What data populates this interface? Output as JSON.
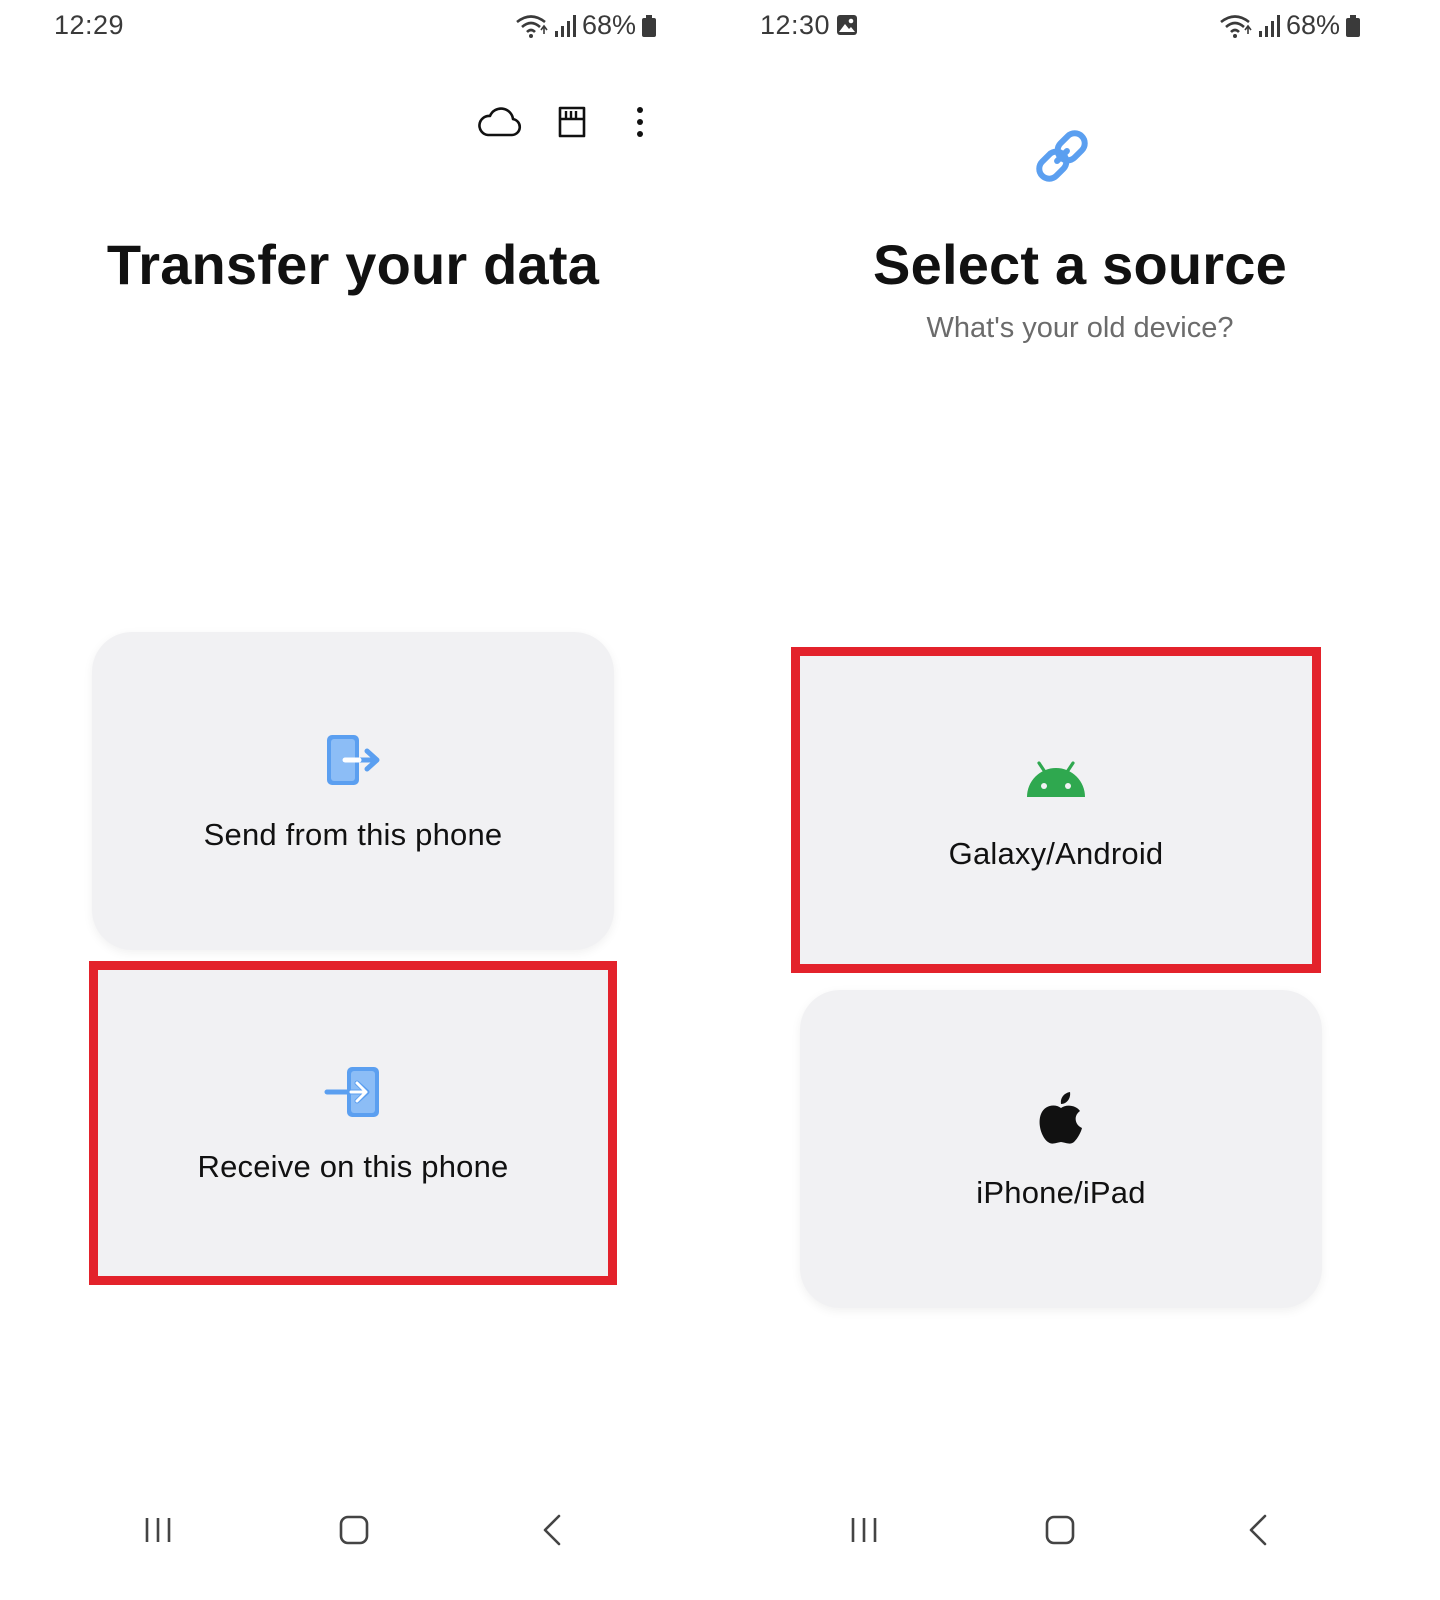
{
  "left_screen": {
    "status": {
      "time": "12:29",
      "battery": "68%"
    },
    "toolbar": {
      "icons": [
        "cloud-icon",
        "sd-card-icon",
        "more-vert-icon"
      ]
    },
    "title": "Transfer your data",
    "cards": [
      {
        "label": "Send from this phone",
        "icon": "send-from-phone-icon"
      },
      {
        "label": "Receive on this phone",
        "icon": "receive-on-phone-icon",
        "highlighted": true
      }
    ]
  },
  "right_screen": {
    "status": {
      "time": "12:30",
      "battery": "68%"
    },
    "header_icon": "link-icon",
    "title": "Select a source",
    "subtitle": "What's your old device?",
    "cards": [
      {
        "label": "Galaxy/Android",
        "icon": "android-icon",
        "highlighted": true
      },
      {
        "label": "iPhone/iPad",
        "icon": "apple-icon"
      }
    ]
  },
  "navbar": {
    "icons": [
      "recent-apps-icon",
      "home-icon",
      "back-icon"
    ]
  },
  "colors": {
    "accent_blue": "#5b9ff0",
    "android_green": "#2fa84f",
    "highlight_red": "#e3222b",
    "card_bg": "#f1f1f3"
  }
}
